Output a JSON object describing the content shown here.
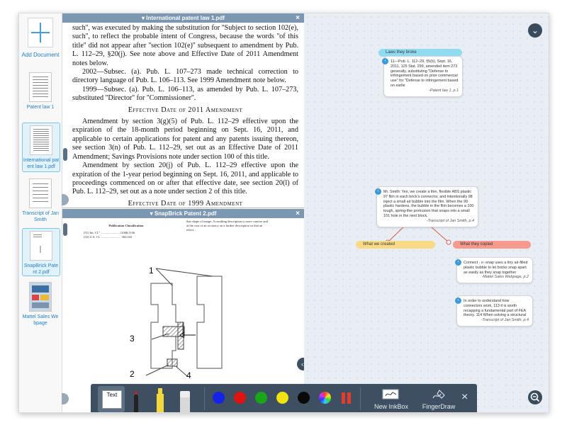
{
  "sidebar": {
    "add_document_label": "Add Document",
    "items": [
      {
        "label": "Patent law 1",
        "selected": false
      },
      {
        "label": "International patent law 1.pdf",
        "selected": true
      },
      {
        "label": "Transcript of Jan Smith",
        "selected": false
      },
      {
        "label": "SnapBrick Patent 2.pdf",
        "selected": true
      },
      {
        "label": "Mattel Sales Webpage",
        "selected": false
      }
    ]
  },
  "pane_top": {
    "title": "International patent law 1.pdf",
    "close": "×",
    "para1": "such'', was executed by making the substitution for ''Subject to section 102(e), such'', to reflect the probable intent of Congress, because the words ''of this title'' did not appear after ''section 102(e)'' subsequent to amendment by Pub. L. 112–29, §20(j). See note above and Effective Date of 2011 Amendment notes below.",
    "para2": "2002—Subsec. (a). Pub. L. 107–273 made technical correction to directory language of Pub. L. 106–113. See 1999 Amendment note below.",
    "para3": "1999—Subsec. (a). Pub. L. 106–113, as amended by Pub. L. 107–273, substituted ''Director'' for ''Commissioner''.",
    "heading1": "Effective Date of 2011 Amendment",
    "para4": "Amendment by section 3(g)(5) of Pub. L. 112–29 effective upon the expiration of the 18-month period beginning on Sept. 16, 2011, and applicable to certain applications for patent and any patents issuing thereon, see section 3(n) of Pub. L. 112–29, set out as an Effective Date of 2011 Amendment; Savings Provisions note under section 100 of this title.",
    "para5": "Amendment by section 20(j) of Pub. L. 112–29 effective upon the expiration of the 1-year period beginning on Sept. 16, 2011, and applicable to proceedings commenced on or after that effective date, see section 20(l) of Pub. L. 112–29, set out as a note under section 2 of this title.",
    "heading2": "Effective Date of 1999 Amendment"
  },
  "pane_bottom": {
    "title": "SnapBrick Patent 2.pdf",
    "close": "×",
    "pub_class": "Publication Classification",
    "class_row1": "(51)   Int. Cl.⁷ ........................ G06K 9/36",
    "class_row2": "(52)   U.S. Cl. ......................... 382/243",
    "abstract": "that shape of image. A resulting description is more concise and at the cost of an accuracy on a further description so that an effect...",
    "fig_labels": [
      "1",
      "3",
      "2",
      "4"
    ]
  },
  "canvas": {
    "tags": [
      {
        "label": "Laws they broke",
        "color": "#8fdcf2"
      },
      {
        "label": "What we created",
        "color": "#f9db86"
      },
      {
        "label": "What they copied",
        "color": "#f59a8c"
      }
    ],
    "cards": [
      {
        "text": "11—Pub. L. 112–29, §5(b), Sept. 16, 2011, 125 Stat. 299, amended item 273 generally, substituting \"Defense to infringement based on prior commercial use\" for \"Defense to infringement based on earlie",
        "source": "-Patent law 1, p.1"
      },
      {
        "text": "Mr. Smith: Yes, we create a thin, flexible ABS plastic   97 film in each brick's connector, and intentionally   98 inject a small air bubble into the film. When the   99 plastic hardens, the bubble in the film becomes a   100 tough, spring-like protrusion that snaps into a small   101 hole in the next block.",
        "source": "-Transcript of Jan Smith, p.4"
      },
      {
        "text": "Connect  -  o  -snap uses a tiny air-filled plastic bubble to let  bricks snap apart as easily as  they snap together",
        "source": "-Mattel Sales Webpage, p.2"
      },
      {
        "text": "In order to understand how connectors work,   113 it is worth recapping a fundamental part of FEA theory.   114 When solving a structural",
        "source": "-Transcript of Jan Smith, p.4"
      }
    ]
  },
  "toolbar": {
    "text_label": "Text",
    "colors": [
      "#1523e6",
      "#e01313",
      "#1aa51a",
      "#f2e20e",
      "#0a0a0a"
    ],
    "new_inkbox_label": "New InkBox",
    "fingerdraw_label": "FingerDraw",
    "close": "×"
  },
  "icons": {
    "collapse": "chevron-down-icon",
    "zoom": "zoom-out-icon",
    "swap": "swap-panes-icon"
  }
}
